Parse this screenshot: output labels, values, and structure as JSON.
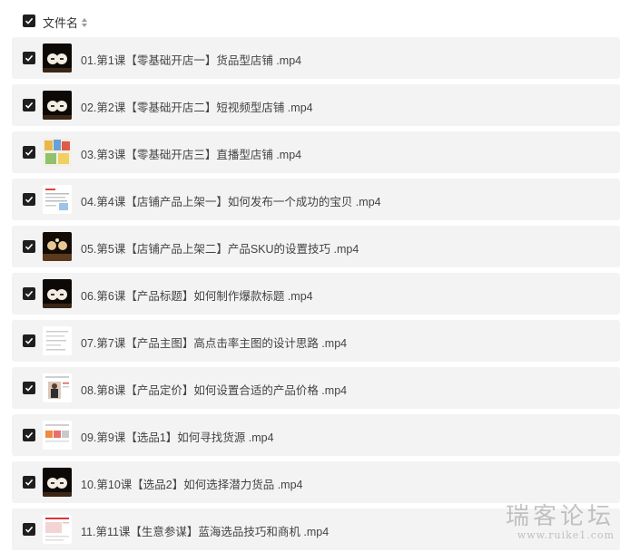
{
  "header": {
    "name_label": "文件名",
    "sort_icon": "sort-updown-icon"
  },
  "files": [
    {
      "label": "01.第1课【零基础开店一】货品型店铺 .mp4",
      "thumb": "dark",
      "checked": true
    },
    {
      "label": "02.第2课【零基础开店二】短视频型店铺 .mp4",
      "thumb": "dark",
      "checked": true
    },
    {
      "label": "03.第3课【零基础开店三】直播型店铺 .mp4",
      "thumb": "colorful",
      "checked": true
    },
    {
      "label": "04.第4课【店铺产品上架一】如何发布一个成功的宝贝 .mp4",
      "thumb": "doc",
      "checked": true
    },
    {
      "label": "05.第5课【店铺产品上架二】产品SKU的设置技巧 .mp4",
      "thumb": "dark-warm",
      "checked": true
    },
    {
      "label": "06.第6课【产品标题】如何制作爆款标题 .mp4",
      "thumb": "dark",
      "checked": true
    },
    {
      "label": "07.第7课【产品主图】高点击率主图的设计思路 .mp4",
      "thumb": "doc-plain",
      "checked": true
    },
    {
      "label": "08.第8课【产品定价】如何设置合适的产品价格 .mp4",
      "thumb": "doc-photo",
      "checked": true
    },
    {
      "label": "09.第9课【选品1】如何寻找货源 .mp4",
      "thumb": "doc-orange",
      "checked": true
    },
    {
      "label": "10.第10课【选品2】如何选择潜力货品 .mp4",
      "thumb": "dark",
      "checked": true
    },
    {
      "label": "11.第11课【生意参谋】蓝海选品技巧和商机 .mp4",
      "thumb": "doc-red",
      "checked": true
    }
  ],
  "watermark": {
    "text": "瑞客论坛",
    "url": "www.ruike1.com"
  }
}
